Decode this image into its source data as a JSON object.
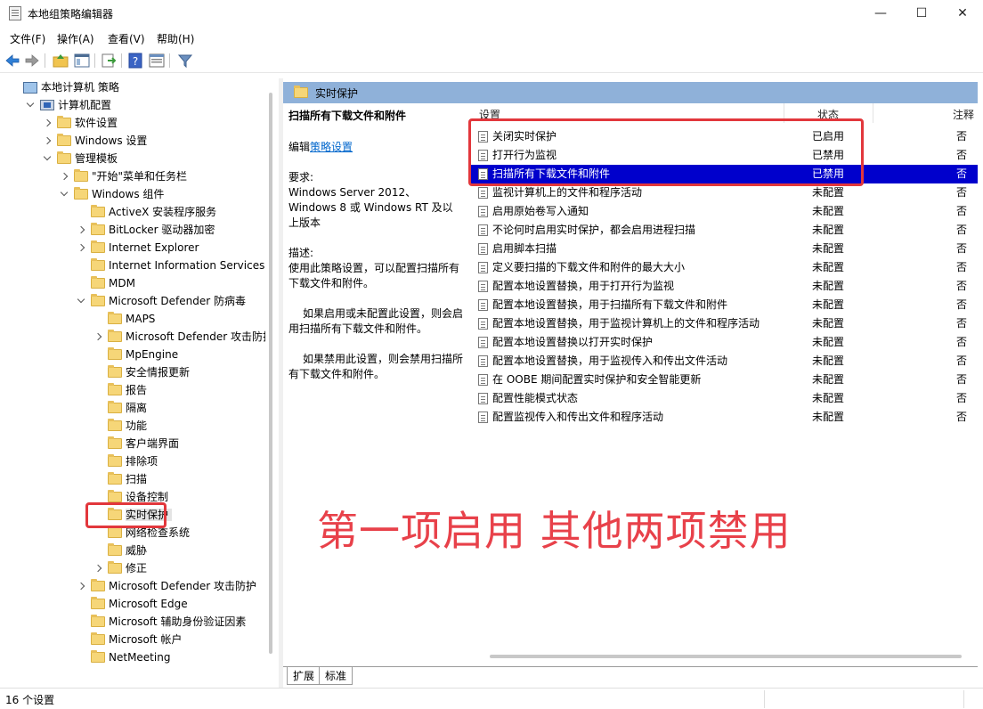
{
  "window": {
    "title": "本地组策略编辑器",
    "minimize": "—",
    "maximize": "☐",
    "close": "✕"
  },
  "menu": [
    "文件(F)",
    "操作(A)",
    "查看(V)",
    "帮助(H)"
  ],
  "tree": {
    "items": [
      {
        "label": "本地计算机 策略",
        "indent": 0,
        "toggle": "none",
        "icon": "computer-icon"
      },
      {
        "label": "计算机配置",
        "indent": 1,
        "toggle": "expanded",
        "icon": "computer-config-icon"
      },
      {
        "label": "软件设置",
        "indent": 2,
        "toggle": "collapsed",
        "icon": "folder-icon"
      },
      {
        "label": "Windows 设置",
        "indent": 2,
        "toggle": "collapsed",
        "icon": "folder-icon"
      },
      {
        "label": "管理模板",
        "indent": 2,
        "toggle": "expanded",
        "icon": "folder-icon"
      },
      {
        "label": "\"开始\"菜单和任务栏",
        "indent": 3,
        "toggle": "collapsed",
        "icon": "folder-icon"
      },
      {
        "label": "Windows 组件",
        "indent": 3,
        "toggle": "expanded",
        "icon": "folder-icon"
      },
      {
        "label": "ActiveX 安装程序服务",
        "indent": 4,
        "toggle": "none",
        "icon": "folder-icon"
      },
      {
        "label": "BitLocker 驱动器加密",
        "indent": 4,
        "toggle": "collapsed",
        "icon": "folder-icon"
      },
      {
        "label": "Internet Explorer",
        "indent": 4,
        "toggle": "collapsed",
        "icon": "folder-icon"
      },
      {
        "label": "Internet Information Services",
        "indent": 4,
        "toggle": "none",
        "icon": "folder-icon"
      },
      {
        "label": "MDM",
        "indent": 4,
        "toggle": "none",
        "icon": "folder-icon"
      },
      {
        "label": "Microsoft Defender 防病毒",
        "indent": 4,
        "toggle": "expanded",
        "icon": "folder-icon"
      },
      {
        "label": "MAPS",
        "indent": 5,
        "toggle": "none",
        "icon": "folder-icon"
      },
      {
        "label": "Microsoft Defender 攻击防护",
        "indent": 5,
        "toggle": "collapsed",
        "icon": "folder-icon"
      },
      {
        "label": "MpEngine",
        "indent": 5,
        "toggle": "none",
        "icon": "folder-icon"
      },
      {
        "label": "安全情报更新",
        "indent": 5,
        "toggle": "none",
        "icon": "folder-icon"
      },
      {
        "label": "报告",
        "indent": 5,
        "toggle": "none",
        "icon": "folder-icon"
      },
      {
        "label": "隔离",
        "indent": 5,
        "toggle": "none",
        "icon": "folder-icon"
      },
      {
        "label": "功能",
        "indent": 5,
        "toggle": "none",
        "icon": "folder-icon"
      },
      {
        "label": "客户端界面",
        "indent": 5,
        "toggle": "none",
        "icon": "folder-icon"
      },
      {
        "label": "排除项",
        "indent": 5,
        "toggle": "none",
        "icon": "folder-icon"
      },
      {
        "label": "扫描",
        "indent": 5,
        "toggle": "none",
        "icon": "folder-icon"
      },
      {
        "label": "设备控制",
        "indent": 5,
        "toggle": "none",
        "icon": "folder-icon"
      },
      {
        "label": "实时保护",
        "indent": 5,
        "toggle": "none",
        "icon": "folder-icon",
        "selected": true
      },
      {
        "label": "网络检查系统",
        "indent": 5,
        "toggle": "none",
        "icon": "folder-icon"
      },
      {
        "label": "威胁",
        "indent": 5,
        "toggle": "none",
        "icon": "folder-icon"
      },
      {
        "label": "修正",
        "indent": 5,
        "toggle": "collapsed",
        "icon": "folder-icon"
      },
      {
        "label": "Microsoft Defender 攻击防护",
        "indent": 4,
        "toggle": "collapsed",
        "icon": "folder-icon"
      },
      {
        "label": "Microsoft Edge",
        "indent": 4,
        "toggle": "none",
        "icon": "folder-icon"
      },
      {
        "label": "Microsoft 辅助身份验证因素",
        "indent": 4,
        "toggle": "none",
        "icon": "folder-icon"
      },
      {
        "label": "Microsoft 帐户",
        "indent": 4,
        "toggle": "none",
        "icon": "folder-icon"
      },
      {
        "label": "NetMeeting",
        "indent": 4,
        "toggle": "none",
        "icon": "folder-icon"
      }
    ]
  },
  "pane": {
    "header": "实时保护",
    "desc_title": "扫描所有下载文件和附件",
    "edit_prefix": "编辑",
    "edit_link": "策略设置",
    "req_label": "要求:",
    "req_text": "Windows Server 2012、Windows 8 或 Windows RT 及以上版本",
    "desc_label": "描述:",
    "desc_p1": "使用此策略设置，可以配置扫描所有下载文件和附件。",
    "desc_p2": "如果启用或未配置此设置，则会启用扫描所有下载文件和附件。",
    "desc_p3": "如果禁用此设置，则会禁用扫描所有下载文件和附件。"
  },
  "list": {
    "col_setting": "设置",
    "col_state": "状态",
    "col_note": "注释",
    "rows": [
      {
        "name": "关闭实时保护",
        "state": "已启用",
        "note": "否"
      },
      {
        "name": "打开行为监视",
        "state": "已禁用",
        "note": "否"
      },
      {
        "name": "扫描所有下载文件和附件",
        "state": "已禁用",
        "note": "否",
        "selected": true
      },
      {
        "name": "监视计算机上的文件和程序活动",
        "state": "未配置",
        "note": "否"
      },
      {
        "name": "启用原始卷写入通知",
        "state": "未配置",
        "note": "否"
      },
      {
        "name": "不论何时启用实时保护，都会启用进程扫描",
        "state": "未配置",
        "note": "否"
      },
      {
        "name": "启用脚本扫描",
        "state": "未配置",
        "note": "否"
      },
      {
        "name": "定义要扫描的下载文件和附件的最大大小",
        "state": "未配置",
        "note": "否"
      },
      {
        "name": "配置本地设置替换，用于打开行为监视",
        "state": "未配置",
        "note": "否"
      },
      {
        "name": "配置本地设置替换，用于扫描所有下载文件和附件",
        "state": "未配置",
        "note": "否"
      },
      {
        "name": "配置本地设置替换，用于监视计算机上的文件和程序活动",
        "state": "未配置",
        "note": "否"
      },
      {
        "name": "配置本地设置替换以打开实时保护",
        "state": "未配置",
        "note": "否"
      },
      {
        "name": "配置本地设置替换，用于监视传入和传出文件活动",
        "state": "未配置",
        "note": "否"
      },
      {
        "name": "在 OOBE 期间配置实时保护和安全智能更新",
        "state": "未配置",
        "note": "否"
      },
      {
        "name": "配置性能模式状态",
        "state": "未配置",
        "note": "否"
      },
      {
        "name": "配置监视传入和传出文件和程序活动",
        "state": "未配置",
        "note": "否"
      }
    ]
  },
  "tabs": [
    "扩展",
    "标准"
  ],
  "status": "16 个设置",
  "annotation": "第一项启用 其他两项禁用",
  "colors": {
    "selection": "#0000cc",
    "header": "#8fb1d9",
    "highlight_box": "#e2373c",
    "annotation": "#e8414a"
  }
}
